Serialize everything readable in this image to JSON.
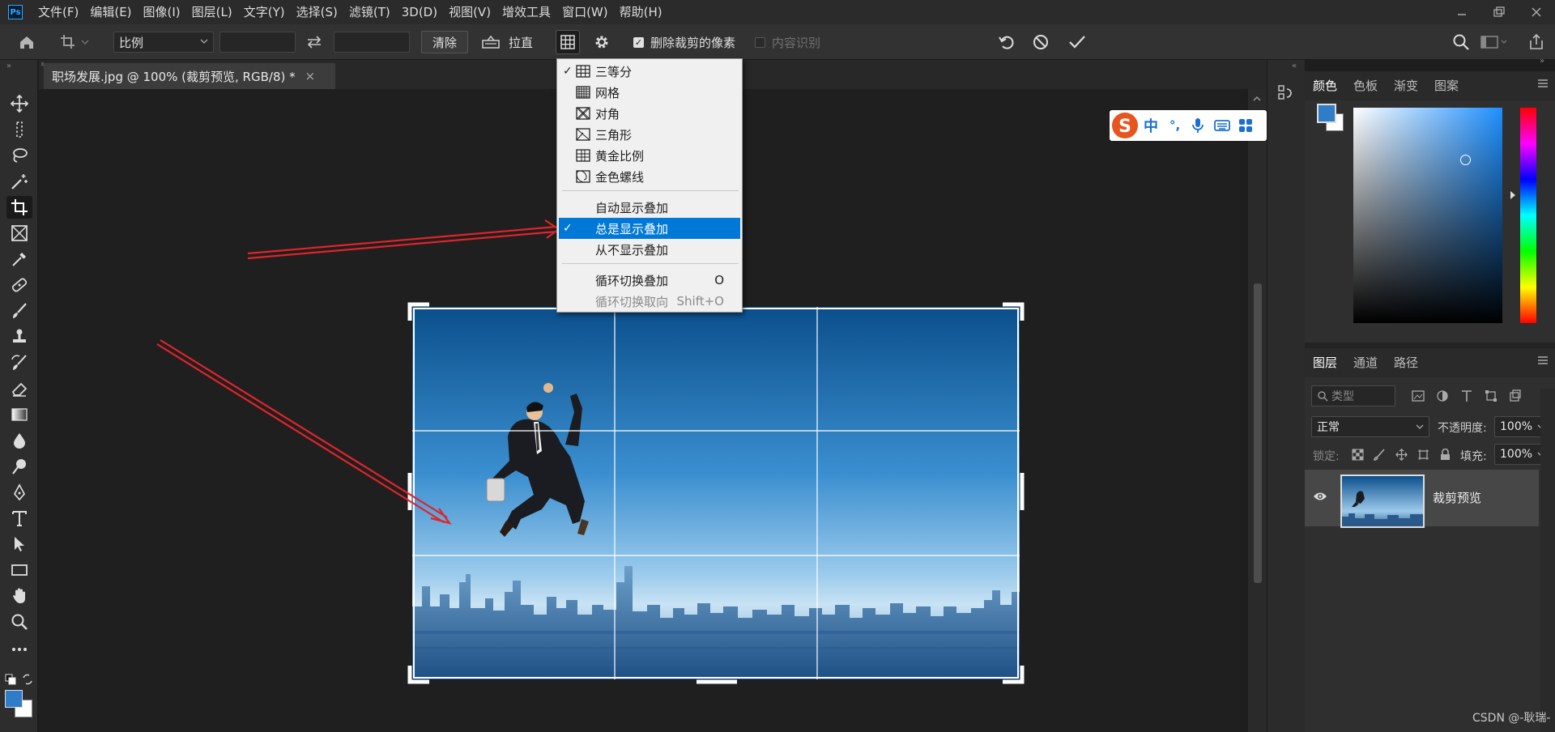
{
  "app": {
    "logo": "Ps"
  },
  "menubar": {
    "items": [
      "文件(F)",
      "编辑(E)",
      "图像(I)",
      "图层(L)",
      "文字(Y)",
      "选择(S)",
      "滤镜(T)",
      "3D(D)",
      "视图(V)",
      "增效工具",
      "窗口(W)",
      "帮助(H)"
    ]
  },
  "options": {
    "ratio_value": "比例",
    "clear_label": "清除",
    "straighten_label": "拉直",
    "delete_pixels_label": "删除裁剪的像素",
    "delete_pixels_checked": true,
    "content_aware_label": "内容识别",
    "content_aware_checked": false
  },
  "document": {
    "tab_title": "职场发展.jpg @ 100% (裁剪预览, RGB/8) *",
    "close": "×"
  },
  "overlay_menu": {
    "overlays": [
      {
        "label": "三等分",
        "checked": true,
        "icon": "thirds-icon"
      },
      {
        "label": "网格",
        "checked": false,
        "icon": "grid-icon"
      },
      {
        "label": "对角",
        "checked": false,
        "icon": "diagonal-icon"
      },
      {
        "label": "三角形",
        "checked": false,
        "icon": "triangle-icon"
      },
      {
        "label": "黄金比例",
        "checked": false,
        "icon": "golden-ratio-icon"
      },
      {
        "label": "金色螺线",
        "checked": false,
        "icon": "golden-spiral-icon"
      }
    ],
    "display_modes": [
      {
        "label": "自动显示叠加",
        "checked": false
      },
      {
        "label": "总是显示叠加",
        "checked": true
      },
      {
        "label": "从不显示叠加",
        "checked": false
      }
    ],
    "cycle_overlay": {
      "label": "循环切换叠加",
      "shortcut": "O"
    },
    "cycle_orientation": {
      "label": "循环切换取向",
      "shortcut": "Shift+O"
    }
  },
  "ime": {
    "mode": "中",
    "punct": "°,"
  },
  "color_panel": {
    "tabs": [
      "颜色",
      "色板",
      "渐变",
      "图案"
    ],
    "foreground": "#2f7cc8",
    "background": "#ffffff"
  },
  "layers_panel": {
    "tabs": [
      "图层",
      "通道",
      "路径"
    ],
    "kind_placeholder": "类型",
    "blend_mode": "正常",
    "opacity_label": "不透明度:",
    "opacity_value": "100%",
    "lock_label": "锁定:",
    "fill_label": "填充:",
    "fill_value": "100%",
    "layers": [
      {
        "name": "裁剪预览",
        "visible": true
      }
    ]
  },
  "watermark": "CSDN @-耿瑞-",
  "colors": {
    "accent": "#0078d7",
    "arrow": "#e0242a"
  }
}
